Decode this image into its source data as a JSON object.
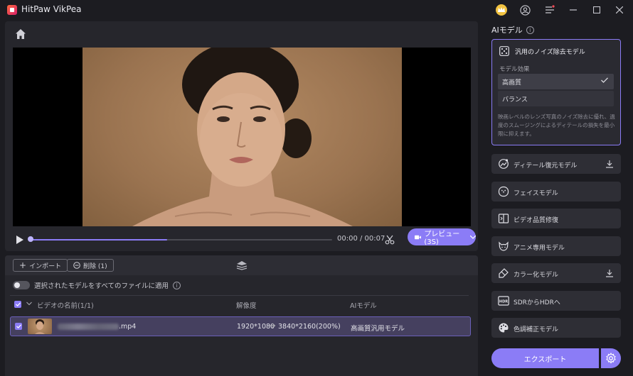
{
  "app": {
    "title": "HitPaw VikPea"
  },
  "preview": {
    "time": "00:00 / 00:07",
    "progress": 0.45,
    "preview_button": "プレビュー(3S)"
  },
  "list": {
    "import_label": "インポート",
    "delete_label": "削除 (1)",
    "apply_all_label": "選択されたモデルをすべてのファイルに適用",
    "columns": {
      "name": "ビデオの名前(1/1)",
      "resolution": "解像度",
      "model": "AIモデル"
    },
    "files": [
      {
        "ext": ".mp4",
        "resolution_from": "1920*1080",
        "resolution_to": "3840*2160(200%)",
        "model": "高画質汎用モデル"
      }
    ]
  },
  "panel": {
    "title": "AIモデル",
    "selected_model": {
      "title": "汎用のノイズ除去モデル",
      "effect_label": "モデル効果",
      "options": [
        "高画質",
        "バランス"
      ],
      "selected_option": "高画質",
      "description": "映画レベルのレンズ写真のノイズ除去に優れ、過度のスムージングによるディテールの損失を最小限に抑えます。"
    },
    "models": [
      {
        "label": "ディテール復元モデル",
        "icon": "detail-icon",
        "download": true
      },
      {
        "label": "フェイスモデル",
        "icon": "face-icon",
        "download": false
      },
      {
        "label": "ビデオ品質修復",
        "icon": "video-repair-icon",
        "download": false
      },
      {
        "label": "アニメ専用モデル",
        "icon": "anime-icon",
        "download": false
      },
      {
        "label": "カラー化モデル",
        "icon": "colorize-icon",
        "download": true
      },
      {
        "label": "SDRからHDRへ",
        "icon": "hdr-icon",
        "download": false
      },
      {
        "label": "色調補正モデル",
        "icon": "palette-icon",
        "download": false
      }
    ],
    "export_label": "エクスポート"
  },
  "colors": {
    "accent": "#8b7cf6",
    "background": "#1c1c21",
    "panel": "#26262c"
  }
}
